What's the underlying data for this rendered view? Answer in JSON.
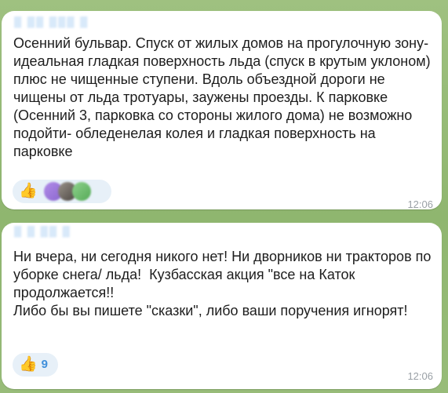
{
  "colors": {
    "chat_background": "#93b878",
    "bubble": "#ffffff",
    "sender_name": "#5aa0e6",
    "reaction_pill": "#e7f0f8",
    "reaction_count": "#3f8fdb",
    "timestamp": "#9aa0a6"
  },
  "messages": [
    {
      "sender": "▒ ▒▒ ▒▒▒ ▒",
      "text": "Осенний бульвар. Спуск от жилых домов на прогулочную зону- идеальная гладкая поверхность льда (спуск в крутым уклоном) плюс не чищенные ступени. Вдоль объездной дороги не чищены от льда тротуары, заужены проезды. К парковке (Осенний 3, парковка со стороны жилого дома) не возможно подойти- обледенелая колея и гладкая поверхность на парковке",
      "reaction": {
        "emoji": "👍",
        "icon": "thumbs-up-icon",
        "avatars": [
          "reactor-avatar-1",
          "reactor-avatar-2",
          "reactor-avatar-3"
        ]
      },
      "time": "12:06"
    },
    {
      "sender": "▒ ▒ ▒▒ ▒",
      "text": "Ни вчера, ни сегодня никого нет! Ни дворников ни тракторов по уборке снега/ льда!  Кузбасская акция \"все на Каток продолжается!!\nЛибо бы вы пишете \"сказки\", либо ваши поручения игнорят!",
      "reaction": {
        "emoji": "👍",
        "icon": "thumbs-up-icon",
        "count": "9"
      },
      "time": "12:06"
    }
  ]
}
